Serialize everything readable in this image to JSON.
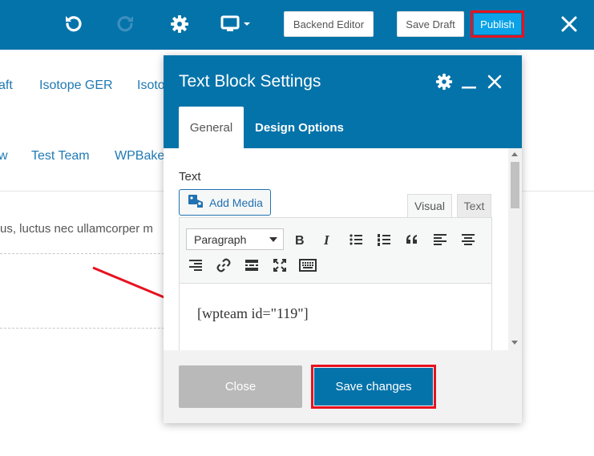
{
  "toolbar": {
    "icons": [
      "undo-icon",
      "redo-icon",
      "settings-gear-icon",
      "responsive-view-icon",
      "close-icon"
    ],
    "backend_editor_label": "Backend Editor",
    "save_draft_label": "Save Draft",
    "publish_label": "Publish",
    "colors": {
      "bar": "#0473aa",
      "publish": "#0ba2e7",
      "highlight": "#e8121f"
    }
  },
  "background": {
    "tabs_row1": [
      "aft",
      "Isotope GER",
      "Isoto"
    ],
    "tabs_row2": [
      "w",
      "Test Team",
      "WPBake"
    ],
    "body_text": "us, luctus nec ullamcorper m"
  },
  "modal": {
    "title": "Text Block Settings",
    "header_icons": [
      "gear-icon",
      "minimize-icon",
      "close-icon"
    ],
    "tabs": {
      "general": "General",
      "design": "Design Options"
    },
    "field_label": "Text",
    "add_media_label": "Add Media",
    "editor_tabs": {
      "visual": "Visual",
      "text": "Text"
    },
    "format_select": "Paragraph",
    "toolbar_buttons": [
      "bold",
      "italic",
      "bulleted-list",
      "numbered-list",
      "blockquote",
      "align-left",
      "align-center",
      "align-right",
      "insert-link",
      "read-more-tag",
      "fullscreen",
      "toolbar-toggle"
    ],
    "content": "[wpteam id=\"119\"]",
    "close_label": "Close",
    "save_label": "Save changes"
  }
}
